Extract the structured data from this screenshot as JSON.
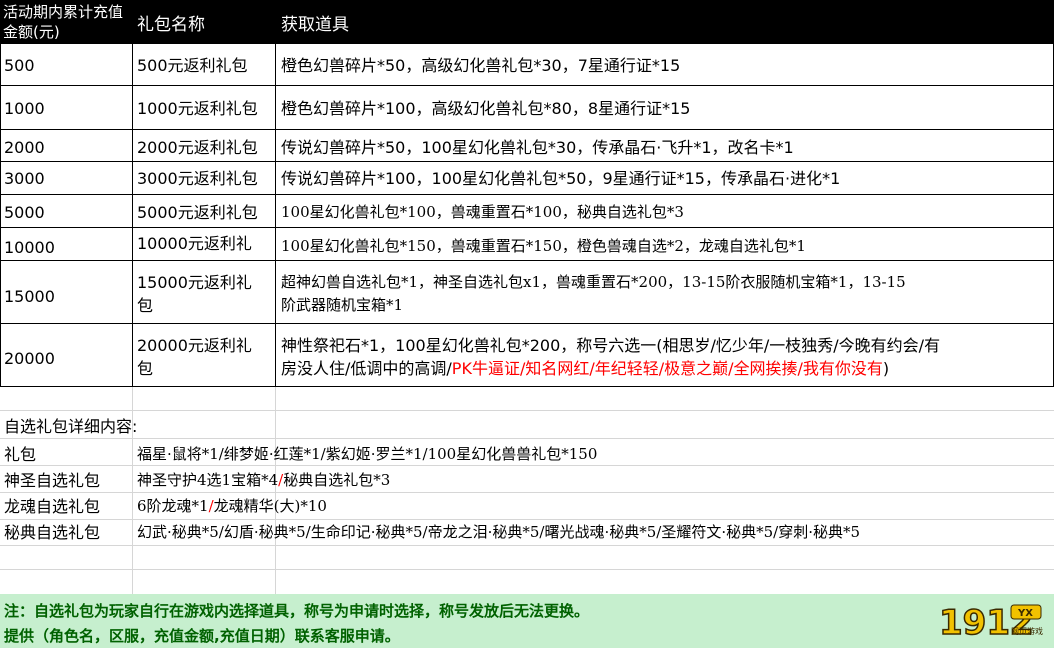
{
  "header": {
    "col1": "活动期内累计充值金额(元)",
    "col2": "礼包名称",
    "col3": "获取道具"
  },
  "rows": [
    {
      "amount": "500",
      "name": "500元返利礼包",
      "items": "橙色幻兽碎片*50，高级幻化兽礼包*30，7星通行证*15"
    },
    {
      "amount": "1000",
      "name": "1000元返利礼包",
      "items": "橙色幻兽碎片*100，高级幻化兽礼包*80，8星通行证*15"
    },
    {
      "amount": "2000",
      "name": "2000元返利礼包",
      "items": "传说幻兽碎片*50，100星幻化兽礼包*30，传承晶石·飞升*1，改名卡*1"
    },
    {
      "amount": "3000",
      "name": "3000元返利礼包",
      "items": "传说幻兽碎片*100，100星幻化兽礼包*50，9星通行证*15，传承晶石·进化*1"
    },
    {
      "amount": "5000",
      "name": "5000元返利礼包",
      "items": "100星幻化兽礼包*100，兽魂重置石*100，秘典自选礼包*3"
    },
    {
      "amount": "10000",
      "name": "10000元返利礼",
      "items": "100星幻化兽礼包*150，兽魂重置石*150，橙色兽魂自选*2，龙魂自选礼包*1"
    },
    {
      "amount": "15000",
      "name_line1": "15000元返利礼",
      "name_line2": "包",
      "items_line1": "超神幻兽自选礼包*1，神圣自选礼包x1，兽魂重置石*200，13-15阶衣服随机宝箱*1，13-15",
      "items_line2": "阶武器随机宝箱*1"
    },
    {
      "amount": "20000",
      "name_line1": "20000元返利礼",
      "name_line2": "包",
      "items_line1": "神性祭祀石*1，100星幻化兽礼包*200，称号六选一(相思岁/忆少年/一枝独秀/今晚有约会/有",
      "items_line2_a": "房没人住/低调中的高调/",
      "items_line2_b": "PK牛逼证/知名网红/年纪轻轻/极意之巅/全网挨揍/我有你没有",
      "items_line2_c": ")"
    }
  ],
  "details": {
    "title": "自选礼包详细内容:",
    "rows": [
      {
        "name": "礼包",
        "content": "福星·鼠将*1/绯梦姬·红莲*1/紫幻姬·罗兰*1/100星幻化兽兽礼包*150"
      },
      {
        "name": "神圣自选礼包",
        "content_a": "神圣守护4选1宝箱*4",
        "content_sep": "/",
        "content_b": "秘典自选礼包*3"
      },
      {
        "name": "龙魂自选礼包",
        "content_a": "6阶龙魂*1",
        "content_sep": "/",
        "content_b": "龙魂精华(大)*10"
      },
      {
        "name": "秘典自选礼包",
        "content": "幻武·秘典*5/幻盾·秘典*5/生命印记·秘典*5/帝龙之泪·秘典*5/曙光战魂·秘典*5/圣耀符文·秘典*5/穿刺·秘典*5"
      }
    ]
  },
  "note": {
    "line1": "注：自选礼包为玩家自行在游戏内选择道具，称号为申请时选择，称号发放后无法更换。",
    "line2": "提供（角色名，区服，充值金额,充值日期）联系客服申请。"
  },
  "logo": {
    "main": "1912",
    "badge_top": "YX",
    "badge_bottom": "网页游戏"
  },
  "colors": {
    "header_bg": "#000000",
    "note_bg": "#c6efce",
    "note_text": "#006100",
    "highlight": "#ff0000",
    "logo": "#f2c200"
  }
}
